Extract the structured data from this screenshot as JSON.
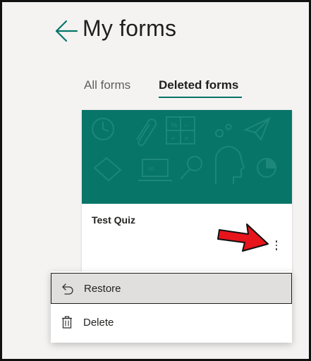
{
  "header": {
    "title": "My forms",
    "back_icon": "arrow-left-icon"
  },
  "tabs": [
    {
      "label": "All forms",
      "selected": false
    },
    {
      "label": "Deleted forms",
      "selected": true
    }
  ],
  "accent_color": "#077568",
  "card": {
    "title": "Test Quiz",
    "banner_color": "#077568",
    "more_icon": "more-vertical-icon"
  },
  "annotation": {
    "arrow_color": "#e8141c",
    "icon": "red-pointer-arrow"
  },
  "context_menu": {
    "items": [
      {
        "label": "Restore",
        "icon": "undo-icon",
        "highlighted": true
      },
      {
        "label": "Delete",
        "icon": "trash-icon",
        "highlighted": false
      }
    ]
  }
}
